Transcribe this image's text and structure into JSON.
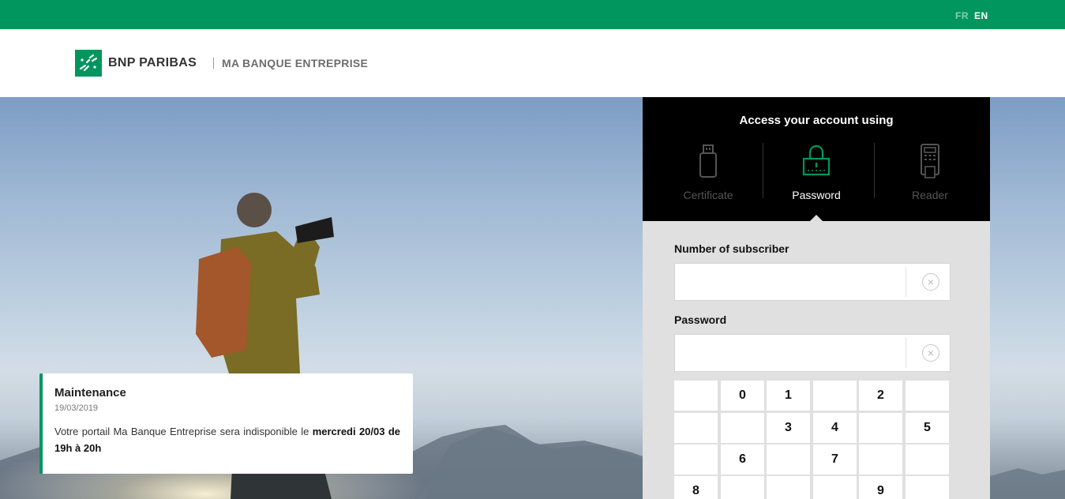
{
  "topbar": {
    "lang_fr": "FR",
    "lang_en": "EN",
    "active_lang": "EN",
    "color": "#00965e"
  },
  "header": {
    "brand": "BNP PARIBAS",
    "subtitle": "MA BANQUE ENTREPRISE"
  },
  "notice": {
    "title": "Maintenance",
    "date": "19/03/2019",
    "text": "Votre portail Ma Banque Entreprise sera indisponible le",
    "text_bold": "mercredi 20/03 de 19h à 20h"
  },
  "login": {
    "title": "Access your account using",
    "methods": [
      {
        "label": "Certificate",
        "icon": "usb-key-icon",
        "active": false
      },
      {
        "label": "Password",
        "icon": "padlock-icon",
        "active": true
      },
      {
        "label": "Reader",
        "icon": "card-reader-icon",
        "active": false
      }
    ],
    "subscriber_label": "Number of subscriber",
    "subscriber_value": "",
    "password_label": "Password",
    "password_value": "",
    "clear_icon": "×",
    "keypad": [
      [
        "",
        "0",
        "1",
        "",
        "2",
        ""
      ],
      [
        "",
        "",
        "3",
        "4",
        "",
        "5"
      ],
      [
        "",
        "6",
        "",
        "7",
        "",
        ""
      ],
      [
        "8",
        "",
        "",
        "",
        "9",
        ""
      ]
    ]
  }
}
